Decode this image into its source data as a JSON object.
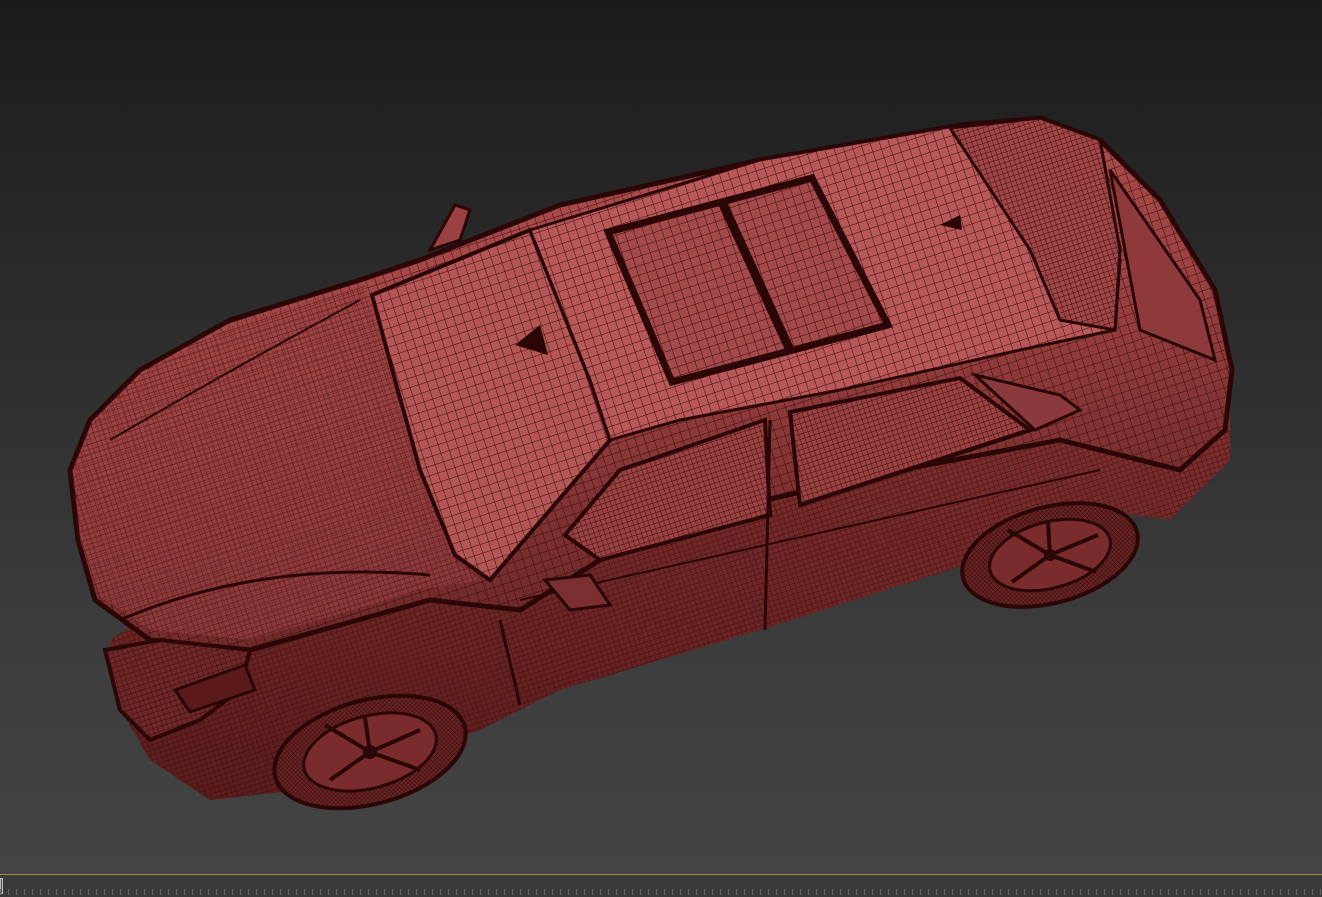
{
  "viewport": {
    "label": "",
    "object": "suv-wireframe-model",
    "display_mode": "shaded-wireframe",
    "background_color_top": "#1b1b1b",
    "background_color_bottom": "#444444",
    "mesh_color": "#a84848",
    "wire_color": "#3a0c0c",
    "outline_color": "#2a0606"
  },
  "timeline": {
    "accent_color": "#a08a3a",
    "frame_position": 0
  }
}
